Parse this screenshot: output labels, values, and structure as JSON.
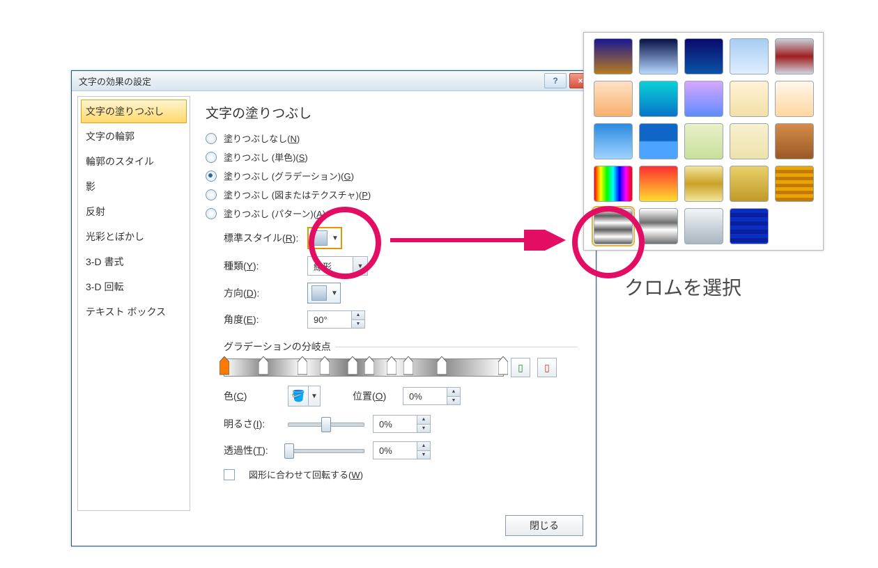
{
  "dialog": {
    "title": "文字の効果の設定",
    "help": "?",
    "close": "×",
    "close_label": "閉じる",
    "nav": [
      "文字の塗りつぶし",
      "文字の輪郭",
      "輪郭のスタイル",
      "影",
      "反射",
      "光彩とぼかし",
      "3-D 書式",
      "3-D 回転",
      "テキスト ボックス"
    ],
    "panel_title": "文字の塗りつぶし",
    "radios": [
      {
        "label": "塗りつぶしなし",
        "key": "N",
        "checked": false
      },
      {
        "label": "塗りつぶし (単色)",
        "key": "S",
        "checked": false
      },
      {
        "label": "塗りつぶし (グラデーション)",
        "key": "G",
        "checked": true
      },
      {
        "label": "塗りつぶし (図またはテクスチャ)",
        "key": "P",
        "checked": false
      },
      {
        "label": "塗りつぶし (パターン)",
        "key": "A",
        "checked": false
      }
    ],
    "fields": {
      "preset_label": "標準スタイル",
      "preset_key": "R",
      "type_label": "種類",
      "type_key": "Y",
      "type_value": "線形",
      "direction_label": "方向",
      "direction_key": "D",
      "angle_label": "角度",
      "angle_key": "E",
      "angle_value": "90°",
      "stops_label": "グラデーションの分岐点",
      "color_label": "色",
      "color_key": "C",
      "position_label": "位置",
      "position_key": "O",
      "position_value": "0%",
      "brightness_label": "明るさ",
      "brightness_key": "I",
      "brightness_value": "0%",
      "transparency_label": "透過性",
      "transparency_key": "T",
      "transparency_value": "0%",
      "rotate_with_shape": "図形に合わせて回転する",
      "rotate_key": "W"
    },
    "stops": [
      0,
      14,
      28,
      36,
      46,
      52,
      60,
      66,
      78,
      100
    ]
  },
  "caption": "クロムを選択",
  "presets": [
    {
      "bg": "linear-gradient(#1b1893,#b87b1e)"
    },
    {
      "bg": "linear-gradient(#071147,#b7d8ff)"
    },
    {
      "bg": "linear-gradient(#0a0a6b,#0b53a7)"
    },
    {
      "bg": "linear-gradient(#a7cdf3,#dfeeff)"
    },
    {
      "bg": "linear-gradient(#c7ced8,#9f1f1f 50%,#cfd5de)"
    },
    {
      "bg": "linear-gradient(#ffe1c6,#f7b06b)"
    },
    {
      "bg": "linear-gradient(#08d1d6,#0775c8)"
    },
    {
      "bg": "linear-gradient(#d6a7ff,#5f8bff)"
    },
    {
      "bg": "linear-gradient(#fff3d6,#f4dfa8)"
    },
    {
      "bg": "linear-gradient(#fff6ea,#ffd7a1)"
    },
    {
      "bg": "linear-gradient(#2b8be0,#9fd2ff)"
    },
    {
      "bg": "linear-gradient(#0f66c6 0%,#0f66c6 48%,#4ca4ff 52%,#4ca4ff 100%)"
    },
    {
      "bg": "linear-gradient(#e8f0c8,#c9e09a)"
    },
    {
      "bg": "linear-gradient(#f8f1d0,#eee2ad)"
    },
    {
      "bg": "linear-gradient(#d48b4a,#9a5a24)"
    },
    {
      "bg": "linear-gradient(to right,#ff0000,#ffff00,#00ff00,#00ffff,#0000ff,#ff00ff,#ff0000)"
    },
    {
      "bg": "linear-gradient(#ff2f2f,#ffdc2f)"
    },
    {
      "bg": "linear-gradient(#f2e49a,#c9a227 50%,#f2e49a)"
    },
    {
      "bg": "linear-gradient(#e8d06a,#c19a28)"
    },
    {
      "bg": "repeating-linear-gradient(#e8a600 0 5px,#c77800 5px 10px)"
    },
    {
      "bg": "linear-gradient(#fff,#5f5f5f 20%,#fff 40%,#5f5f5f 60%,#fff 80%,#5f5f5f)",
      "selected": true,
      "id": "chrome"
    },
    {
      "bg": "linear-gradient(#fff,#707070 40%,#fff 60%,#707070)",
      "id": "chrome2"
    },
    {
      "bg": "linear-gradient(#f2f5f8,#a9b5c0)"
    },
    {
      "bg": "repeating-linear-gradient(#0a2fc0 0 6px,#0820a0 6px 12px)"
    }
  ]
}
